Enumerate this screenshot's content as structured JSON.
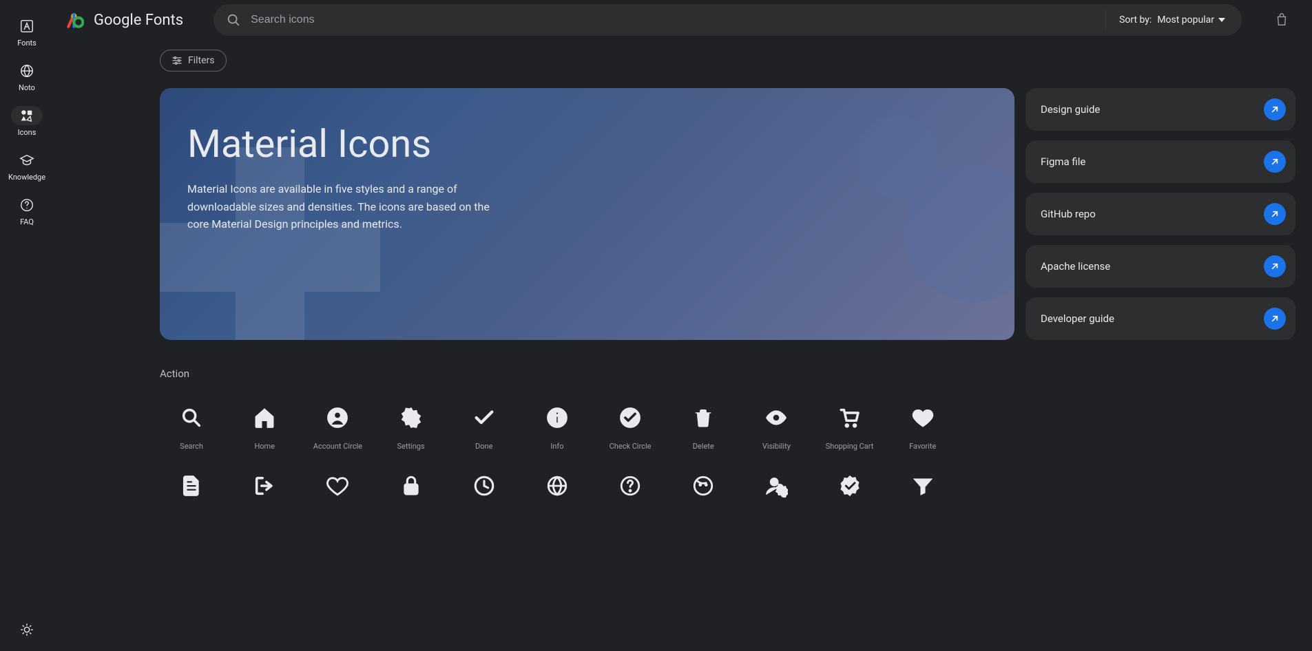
{
  "sidebar": {
    "items": [
      {
        "label": "Fonts",
        "icon": "font-a-icon"
      },
      {
        "label": "Noto",
        "icon": "globe-icon"
      },
      {
        "label": "Icons",
        "icon": "shapes-icon",
        "active": true
      },
      {
        "label": "Knowledge",
        "icon": "graduation-cap-icon"
      },
      {
        "label": "FAQ",
        "icon": "help-circle-icon"
      }
    ]
  },
  "header": {
    "logo_text_1": "Google ",
    "logo_text_2": "Fonts",
    "search_placeholder": "Search icons",
    "sort_prefix": "Sort by: ",
    "sort_value": "Most popular"
  },
  "filters": {
    "chip_label": "Filters"
  },
  "hero": {
    "title": "Material Icons",
    "description": "Material Icons are available in five styles and a range of downloadable sizes and densities. The icons are based on the core Material Design principles and metrics."
  },
  "links": [
    {
      "label": "Design guide"
    },
    {
      "label": "Figma file"
    },
    {
      "label": "GitHub repo"
    },
    {
      "label": "Apache license"
    },
    {
      "label": "Developer guide"
    }
  ],
  "section": {
    "label": "Action"
  },
  "grid_row1": [
    {
      "label": "Search",
      "icon": "search"
    },
    {
      "label": "Home",
      "icon": "home"
    },
    {
      "label": "Account Circle",
      "icon": "account_circle"
    },
    {
      "label": "Settings",
      "icon": "settings"
    },
    {
      "label": "Done",
      "icon": "done"
    },
    {
      "label": "Info",
      "icon": "info"
    },
    {
      "label": "Check Circle",
      "icon": "check_circle"
    },
    {
      "label": "Delete",
      "icon": "delete"
    },
    {
      "label": "Visibility",
      "icon": "visibility"
    },
    {
      "label": "Shopping Cart",
      "icon": "shopping_cart"
    },
    {
      "label": "Favorite",
      "icon": "favorite"
    }
  ],
  "grid_row2": [
    {
      "label": "",
      "icon": "description"
    },
    {
      "label": "",
      "icon": "logout"
    },
    {
      "label": "",
      "icon": "favorite_border"
    },
    {
      "label": "",
      "icon": "lock"
    },
    {
      "label": "",
      "icon": "schedule"
    },
    {
      "label": "",
      "icon": "language"
    },
    {
      "label": "",
      "icon": "help_outline"
    },
    {
      "label": "",
      "icon": "face"
    },
    {
      "label": "",
      "icon": "manage_accounts"
    },
    {
      "label": "",
      "icon": "verified"
    },
    {
      "label": "",
      "icon": "filter_alt"
    }
  ]
}
